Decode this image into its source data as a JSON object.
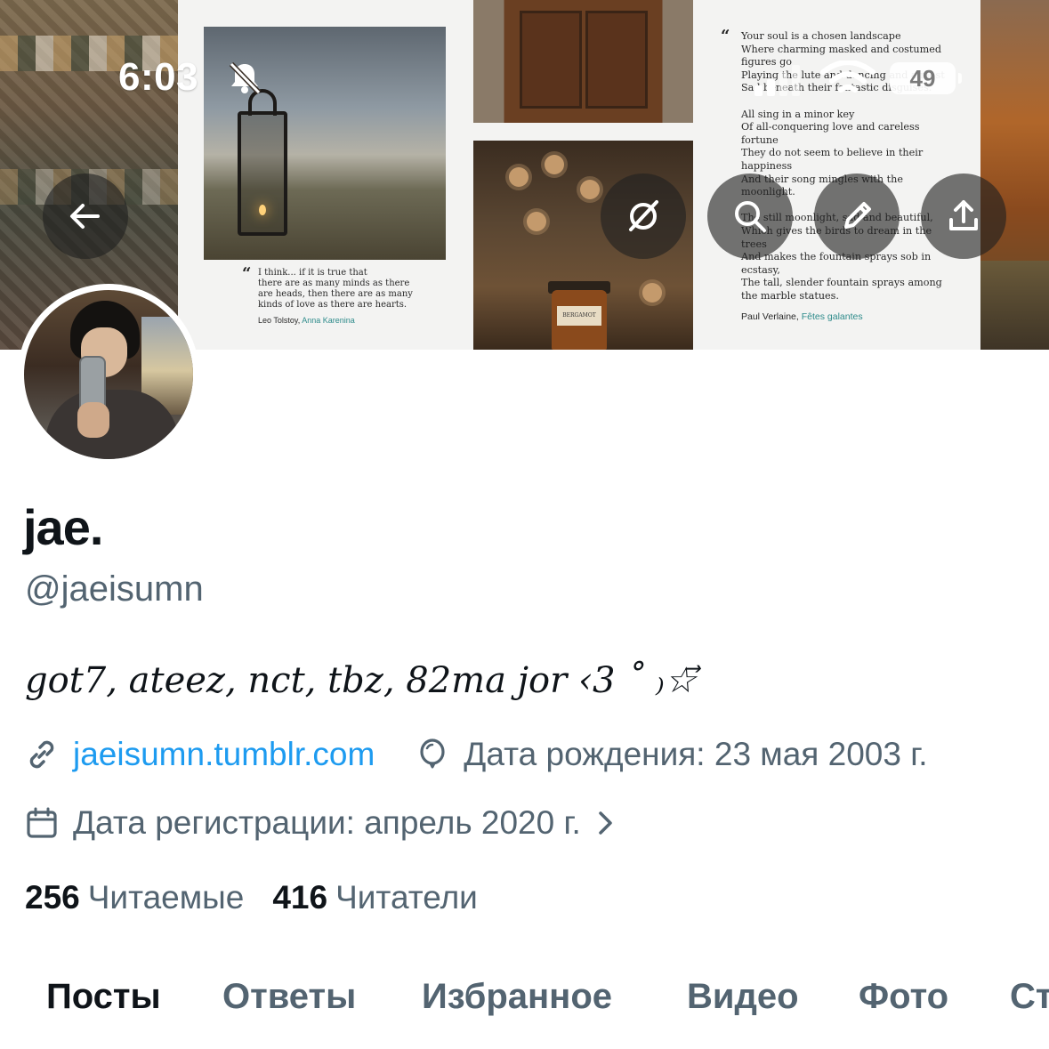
{
  "status_bar": {
    "time": "6:03",
    "battery": "49",
    "icons": [
      "bell-slash-icon",
      "signal-icon",
      "wifi-icon",
      "battery-icon"
    ]
  },
  "banner": {
    "quote_left": {
      "mark": "“",
      "lines": "I think... if it is true that\nthere are as many minds as there\nare heads, then there are as many\nkinds of love as there are hearts.",
      "author": "Leo Tolstoy, ",
      "work": "Anna Karenina"
    },
    "poem": {
      "mark": "“",
      "lines": "Your soul is a chosen landscape\nWhere charming masked and costumed\nfigures go\nPlaying the lute and dancing and almost\nSad beneath their fantastic disguises.\n\nAll sing in a minor key\nOf all-conquering love and careless\nfortune\nThey do not seem to believe in their\nhappiness\nAnd their song mingles with the\nmoonlight.\n\nThe still moonlight, sad and beautiful,\nWhich gives the birds to dream in the\ntrees\nAnd makes the fountain sprays sob in\necstasy,\nThe tall, slender fountain sprays among\nthe marble statues.",
      "author": "Paul Verlaine, ",
      "work": "Fêtes galantes"
    },
    "jar_label": "BERGAMOT"
  },
  "toolbar": {
    "back": "back-arrow-icon",
    "grok": "grok-icon",
    "search": "search-icon",
    "edit": "edit-icon",
    "share": "share-icon"
  },
  "profile": {
    "display_name": "jae.",
    "handle": "@jaeisumn",
    "bio": "got7, ateez, nct, tbz, 82ma jor ‹3 ˚ ₎☆⃗",
    "website": "jaeisumn.tumblr.com",
    "birthday": "Дата рождения: 23 мая 2003 г.",
    "joined": "Дата регистрации: апрель 2020 г."
  },
  "stats": {
    "following_count": "256",
    "following_label": "Читаемые",
    "followers_count": "416",
    "followers_label": "Читатели"
  },
  "tabs": [
    "Посты",
    "Ответы",
    "Избранное",
    "Видео",
    "Фото",
    "Ст"
  ],
  "colors": {
    "accent": "#1d9bf0",
    "text_primary": "#0f1419",
    "text_secondary": "#536471"
  }
}
